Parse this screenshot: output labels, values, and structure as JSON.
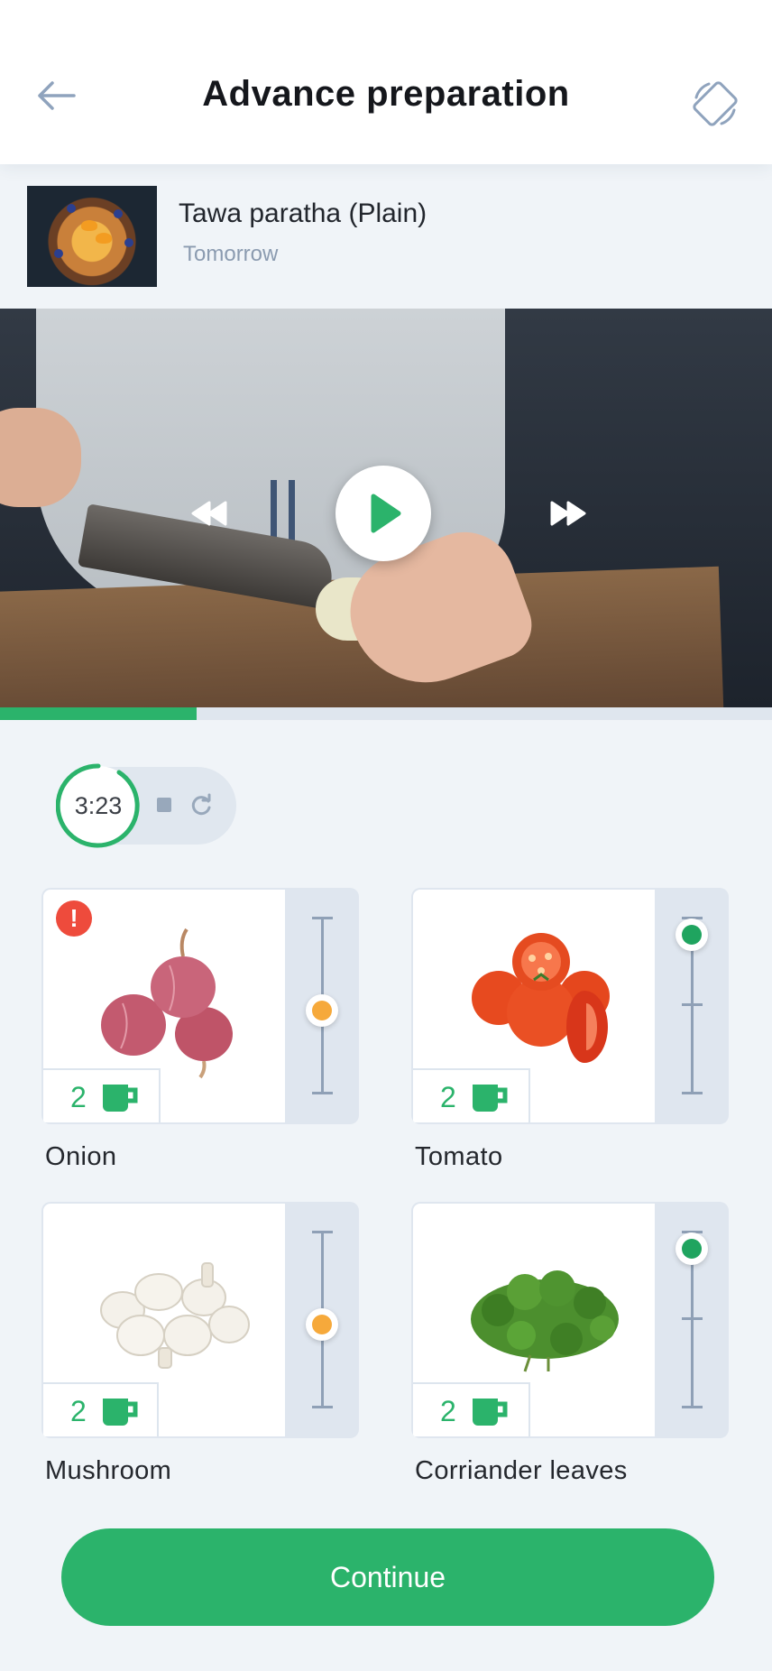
{
  "header": {
    "title": "Advance preparation"
  },
  "recipe": {
    "name": "Tawa paratha (Plain)",
    "when": "Tomorrow"
  },
  "video": {
    "progress": 0.255
  },
  "timer": {
    "display": "3:23"
  },
  "ingredients": [
    {
      "name": "Onion",
      "quantity": "2",
      "unit_icon": "cup-icon",
      "warning": true,
      "level_color": "#f6a93b"
    },
    {
      "name": "Tomato",
      "quantity": "2",
      "unit_icon": "cup-icon",
      "warning": false,
      "level_color": "#1fa45f"
    },
    {
      "name": "Mushroom",
      "quantity": "2",
      "unit_icon": "cup-icon",
      "warning": false,
      "level_color": "#f6a93b"
    },
    {
      "name": "Corriander leaves",
      "quantity": "2",
      "unit_icon": "cup-icon",
      "warning": false,
      "level_color": "#1fa45f"
    }
  ],
  "actions": {
    "continue_label": "Continue"
  },
  "colors": {
    "accent": "#2bb36b",
    "warning": "#ee4b3c",
    "slider_orange": "#f6a93b",
    "slider_green": "#1fa45f"
  }
}
